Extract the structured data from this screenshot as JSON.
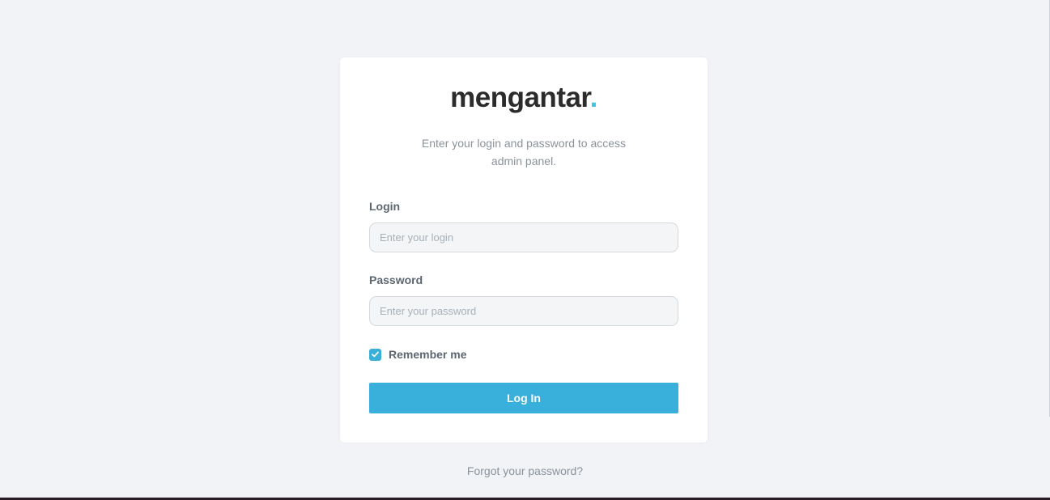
{
  "brand": {
    "name": "mengantar",
    "dot": ".",
    "accent_color": "#3ec6e0"
  },
  "login_card": {
    "subtitle_line1": "Enter your login and password to access",
    "subtitle_line2": "admin panel.",
    "login_label": "Login",
    "login_placeholder": "Enter your login",
    "login_value": "",
    "password_label": "Password",
    "password_placeholder": "Enter your password",
    "password_value": "",
    "remember_label": "Remember me",
    "remember_checked": true,
    "submit_label": "Log In",
    "button_color": "#39afdb"
  },
  "footer": {
    "forgot_label": "Forgot your password?"
  }
}
